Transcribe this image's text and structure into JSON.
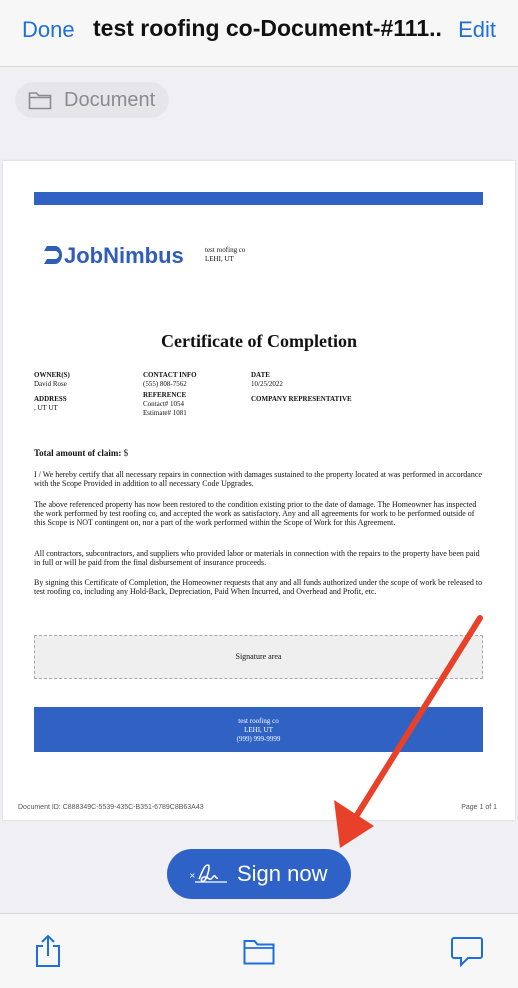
{
  "nav": {
    "done_label": "Done",
    "title": "test roofing co-Document-#111...",
    "edit_label": "Edit"
  },
  "folder_chip": {
    "label": "Document",
    "icon": "folder-icon"
  },
  "document": {
    "logo_text": "JobNimbus",
    "company_name": "test roofing co",
    "company_location": "LEHI, UT",
    "title": "Certificate of Completion",
    "owner_label": "OWNER(S)",
    "owner_value": "David Rose",
    "contact_label": "CONTACT INFO",
    "contact_value": "(555) 808-7562",
    "date_label": "DATE",
    "date_value": "10/25/2022",
    "address_label": "ADDRESS",
    "address_value": ", UT UT",
    "reference_label": "REFERENCE",
    "reference_contact": "Contact# 1054",
    "reference_estimate": "Estimate# 1081",
    "company_rep_label": "COMPANY REPRESENTATIVE",
    "claim_label": "Total amount of claim:",
    "claim_value": "$",
    "paragraphs": [
      "I / We hereby certify that all necessary repairs in connection with damages sustained to the property located at was performed in accordance with the Scope Provided in addition to all necessary Code Upgrades.",
      "The above referenced property has now been restored to the condition existing prior to the date of damage. The Homeowner has inspected the work performed by test roofing co, and accepted the work as satisfactory. Any and all agreements for work to be performed outside of this Scope is NOT contingent on, nor a part of the work performed within the Scope of Work for this Agreement.",
      "All contractors, subcontractors, and suppliers who provided labor or materials in connection with the repairs to the property have been paid in full or will be paid from the final disbursement of insurance proceeds.",
      "By signing this Certificate of Completion, the Homeowner requests that any and all funds authorized under the scope of work be released to test roofing co, including any Hold-Back, Depreciation, Paid When Incurred, and Overhead and Profit, etc."
    ],
    "signature_area": "Signature area",
    "footer_company": "test roofing co",
    "footer_location": "LEHI, UT",
    "footer_phone": "(999) 999-9999",
    "document_id": "Document ID: C888349C-5539-435C-B351-6789C8B63A43",
    "page_number": "Page 1 of 1",
    "accent_color": "#2f62c3"
  },
  "sign_button": {
    "label": "Sign now",
    "icon": "signature-icon"
  },
  "toolbar": {
    "icons": [
      "share-icon",
      "folder-icon",
      "comment-icon"
    ]
  },
  "annotation": {
    "arrow_color": "#e8412a"
  }
}
